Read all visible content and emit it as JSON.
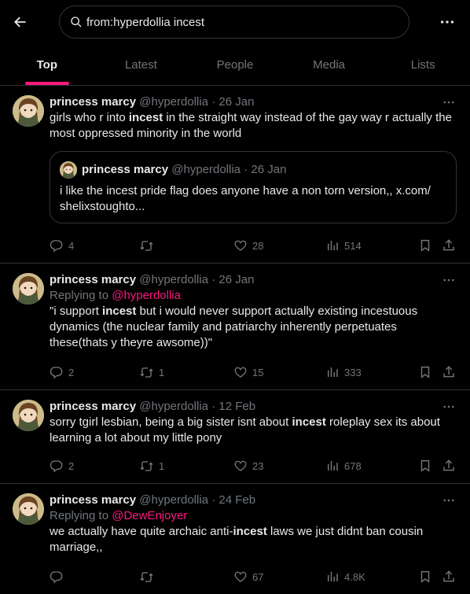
{
  "search": {
    "query": "from:hyperdollia incest"
  },
  "tabs": [
    "Top",
    "Latest",
    "People",
    "Media",
    "Lists"
  ],
  "colors": {
    "accent": "#f91880",
    "muted": "#71767b",
    "text": "#e7e9ea",
    "border": "#2f3336"
  },
  "tweets": [
    {
      "name": "princess marcy",
      "handle": "@hyperdollia",
      "dot": "·",
      "date": "26 Jan",
      "text_before": "girls who r into ",
      "text_bold": "incest",
      "text_after": " in the straight way instead of the gay way r actually the most oppressed minority in the world",
      "quote": {
        "name": "princess marcy",
        "handle": "@hyperdollia",
        "dot": "·",
        "date": "26 Jan",
        "text": "i like the incest pride flag does anyone have a non torn version,, x.com/ shelixstoughto..."
      },
      "replies": "4",
      "retweets": "",
      "likes": "28",
      "views": "514"
    },
    {
      "name": "princess marcy",
      "handle": "@hyperdollia",
      "dot": "·",
      "date": "26 Jan",
      "replying_label": "Replying to ",
      "replying_to": "@hyperdollia",
      "text_before": "\"i support ",
      "text_bold": "incest",
      "text_after": " but i would never support actually existing incestuous dynamics (the nuclear family and patriarchy inherently perpetuates these(thats y theyre awsome))\"",
      "replies": "2",
      "retweets": "1",
      "likes": "15",
      "views": "333"
    },
    {
      "name": "princess marcy",
      "handle": "@hyperdollia",
      "dot": "·",
      "date": "12 Feb",
      "text_before": "sorry tgirl lesbian, being a big sister isnt about ",
      "text_bold": "incest",
      "text_after": " roleplay sex its about learning a lot about my little pony",
      "replies": "2",
      "retweets": "1",
      "likes": "23",
      "views": "678"
    },
    {
      "name": "princess marcy",
      "handle": "@hyperdollia",
      "dot": "·",
      "date": "24 Feb",
      "replying_label": "Replying to ",
      "replying_to": "@DewEnjoyer",
      "text_before": "we actually have quite archaic anti-",
      "text_bold": "incest",
      "text_after": " laws we just didnt ban cousin marriage,,",
      "replies": "",
      "retweets": "",
      "likes": "67",
      "views": "4.8K"
    }
  ]
}
